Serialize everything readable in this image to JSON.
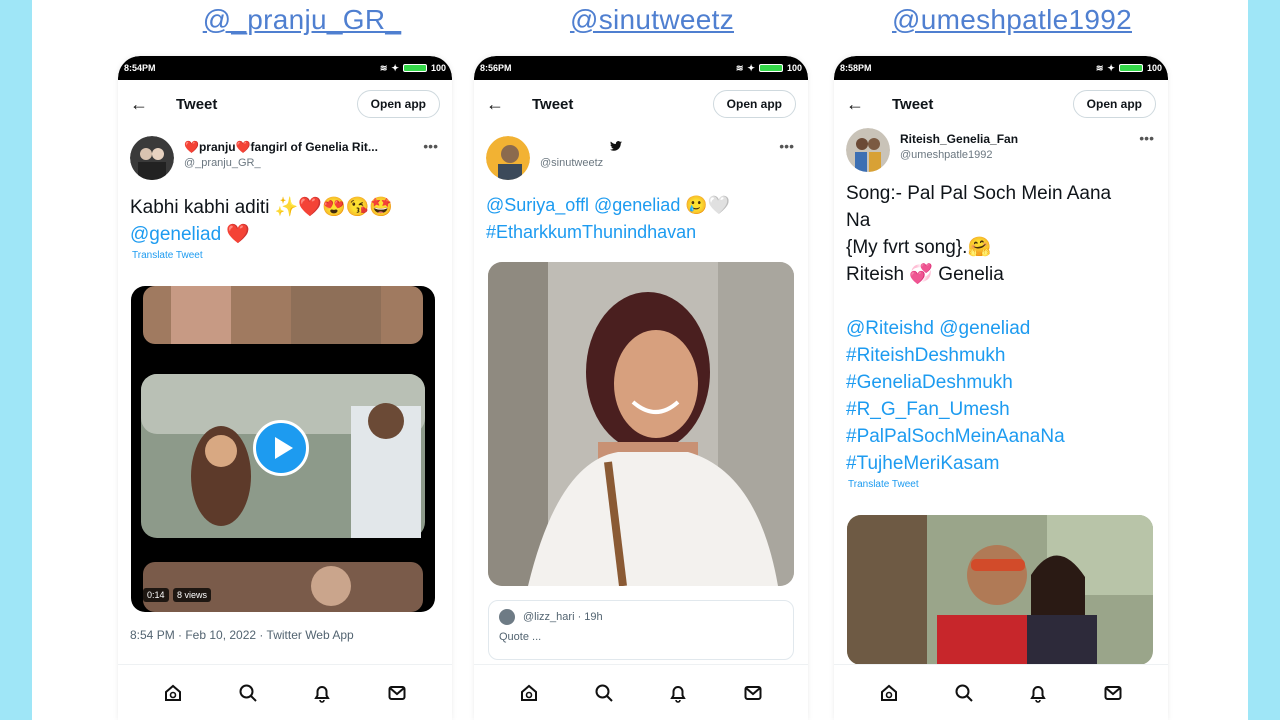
{
  "accent_color": "#1d9bf0",
  "background_color": "#9fe6f7",
  "handle_color": "#4f7fd0",
  "columns": [
    {
      "handle": "@_pranju_GR_",
      "status_time": "8:54PM",
      "status_right": "100",
      "topbar": {
        "back_icon": "back-arrow-icon",
        "title": "Tweet",
        "open_app": "Open app"
      },
      "author": {
        "name": "❤️pranju❤️fangirl of Genelia Rit...",
        "handle": "@_pranju_GR_"
      },
      "tweet_text": "Kabhi kabhi aditi ✨❤️😍😘🤩",
      "tweet_mention": "@geneliad",
      "tweet_mention_emoji": "❤️",
      "translate": "Translate Tweet",
      "video_duration": "0:14",
      "video_views": "8 views",
      "footer": "8:54 PM · Feb 10, 2022 · Twitter Web App"
    },
    {
      "handle": "@sinutweetz",
      "status_time": "8:56PM",
      "status_right": "100",
      "topbar": {
        "back_icon": "back-arrow-icon",
        "title": "Tweet",
        "open_app": "Open app"
      },
      "author": {
        "handle": "@sinutweetz",
        "verified_icon": "twitter-bird-icon"
      },
      "tweet_line1": "@Suriya_offl @geneliad 🥲🤍",
      "tweet_line2": "#EtharkkumThunindhavan",
      "reply": {
        "handle": "@lizz_hari · 19h",
        "snippet": "Quote ..."
      }
    },
    {
      "handle": "@umeshpatle1992",
      "status_time": "8:58PM",
      "status_right": "100",
      "topbar": {
        "back_icon": "back-arrow-icon",
        "title": "Tweet",
        "open_app": "Open app"
      },
      "author": {
        "name": "Riteish_Genelia_Fan",
        "handle": "@umeshpatle1992"
      },
      "tweet_lines": [
        "Song:- Pal Pal Soch Mein Aana",
        "Na",
        "{My fvrt song}.🤗",
        "Riteish 💞 Genelia"
      ],
      "tweet_tags": [
        "@Riteishd @geneliad",
        "#RiteishDeshmukh",
        "#GeneliaDeshmukh",
        "#R_G_Fan_Umesh",
        "#PalPalSochMeinAanaNa",
        "#TujheMeriKasam"
      ],
      "translate": "Translate Tweet"
    }
  ],
  "bottom_nav": [
    "home-icon",
    "search-icon",
    "bell-icon",
    "mail-icon"
  ]
}
